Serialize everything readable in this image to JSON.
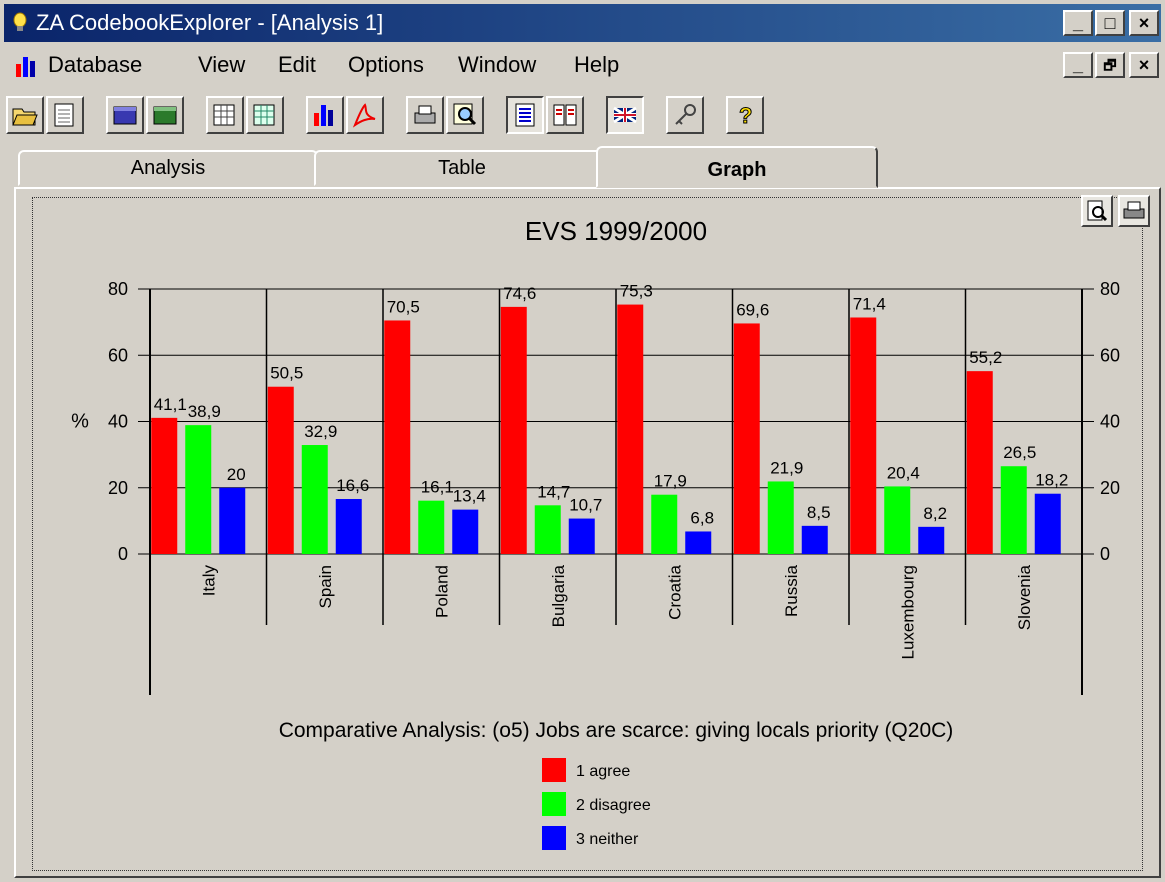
{
  "window": {
    "title": "ZA CodebookExplorer - [Analysis 1]",
    "controls": {
      "minimize": "_",
      "maximize": "□",
      "close": "×",
      "restore": "🗗"
    }
  },
  "menu": [
    "Database",
    "View",
    "Edit",
    "Options",
    "Window",
    "Help"
  ],
  "toolbar": [
    {
      "icon": "open-folder-icon"
    },
    {
      "icon": "document-grid-icon"
    },
    {
      "icon": "database-blue-icon"
    },
    {
      "icon": "database-green-icon"
    },
    {
      "icon": "table-grid-icon"
    },
    {
      "icon": "table-grid-green-icon"
    },
    {
      "icon": "bar-chart-icon"
    },
    {
      "icon": "pdf-icon"
    },
    {
      "icon": "printer-icon"
    },
    {
      "icon": "find-icon"
    },
    {
      "icon": "report-icon"
    },
    {
      "icon": "multi-report-icon"
    },
    {
      "icon": "uk-flag-icon"
    },
    {
      "icon": "key-icon"
    },
    {
      "icon": "help-icon"
    }
  ],
  "tabs": [
    {
      "label": "Analysis",
      "active": false
    },
    {
      "label": "Table",
      "active": false
    },
    {
      "label": "Graph",
      "active": true
    }
  ],
  "colors": {
    "agree": "#ff0000",
    "disagree": "#00ff00",
    "neither": "#0000ff"
  },
  "chart_data": {
    "type": "bar",
    "title": "EVS 1999/2000",
    "ylabel": "%",
    "ylim": [
      0,
      80
    ],
    "yticks": [
      0,
      20,
      40,
      60,
      80
    ],
    "categories": [
      "Italy",
      "Spain",
      "Poland",
      "Bulgaria",
      "Croatia",
      "Russia",
      "Luxembourg",
      "Slovenia"
    ],
    "series": [
      {
        "name": "1 agree",
        "color": "#ff0000",
        "values": [
          41.1,
          50.5,
          70.5,
          74.6,
          75.3,
          69.6,
          71.4,
          55.2
        ],
        "labels": [
          "41,1",
          "50,5",
          "70,5",
          "74,6",
          "75,3",
          "69,6",
          "71,4",
          "55,2"
        ]
      },
      {
        "name": "2 disagree",
        "color": "#00ff00",
        "values": [
          38.9,
          32.9,
          16.1,
          14.7,
          17.9,
          21.9,
          20.4,
          26.5
        ],
        "labels": [
          "38,9",
          "32,9",
          "16,1",
          "14,7",
          "17,9",
          "21,9",
          "20,4",
          "26,5"
        ]
      },
      {
        "name": "3 neither",
        "color": "#0000ff",
        "values": [
          20,
          16.6,
          13.4,
          10.7,
          6.8,
          8.5,
          8.2,
          18.2
        ],
        "labels": [
          "20",
          "16,6",
          "13,4",
          "10,7",
          "6,8",
          "8,5",
          "8,2",
          "18,2"
        ]
      }
    ],
    "caption": "Comparative Analysis: (o5)   Jobs are scarce: giving locals priority (Q20C)",
    "legend_placement": "bottom-center",
    "grid": true
  }
}
